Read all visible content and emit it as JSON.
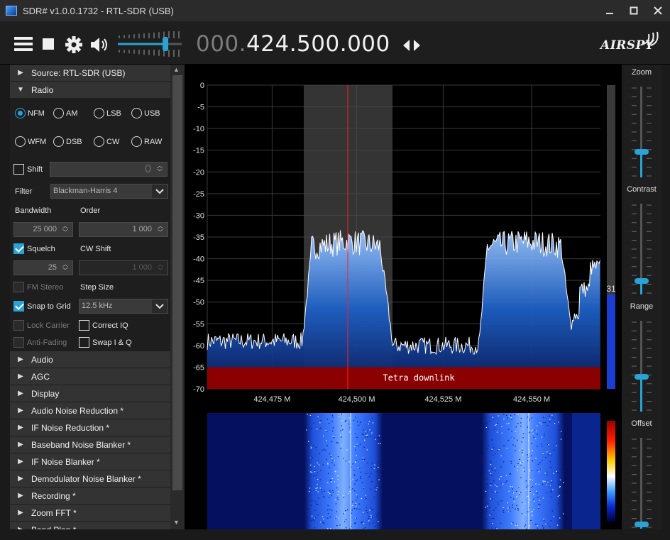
{
  "window": {
    "title": "SDR# v1.0.0.1732 - RTL-SDR (USB)",
    "controls": [
      "minimize",
      "maximize",
      "close"
    ]
  },
  "toolbar": {
    "icons": [
      "menu-icon",
      "stop-icon",
      "gear-icon",
      "speaker-icon"
    ],
    "volume_fraction": 0.78,
    "frequency_dim": "000.",
    "frequency_main": "424.500.000",
    "logo": "AIRSPY"
  },
  "sections_top": [
    {
      "label": "Source: RTL-SDR (USB)",
      "expanded": false
    },
    {
      "label": "Radio",
      "expanded": true
    }
  ],
  "radio": {
    "modes_row1": [
      "NFM",
      "AM",
      "LSB",
      "USB"
    ],
    "modes_row2": [
      "WFM",
      "DSB",
      "CW",
      "RAW"
    ],
    "selected_mode": "NFM",
    "shift_label": "Shift",
    "shift_value": "0",
    "filter_label": "Filter",
    "filter_value": "Blackman-Harris 4",
    "bandwidth_label": "Bandwidth",
    "bandwidth_value": "25 000",
    "order_label": "Order",
    "order_value": "1 000",
    "squelch_label": "Squelch",
    "squelch_value": "25",
    "cw_shift_label": "CW Shift",
    "cw_shift_value": "1 000",
    "fm_stereo_label": "FM Stereo",
    "step_size_label": "Step Size",
    "snap_label": "Snap to Grid",
    "step_size_value": "12.5 kHz",
    "lock_carrier_label": "Lock Carrier",
    "correct_iq_label": "Correct IQ",
    "anti_fading_label": "Anti-Fading",
    "swap_iq_label": "Swap I & Q"
  },
  "sections_bottom": [
    "Audio",
    "AGC",
    "Display",
    "Audio Noise Reduction *",
    "IF Noise Reduction *",
    "Baseband Noise Blanker *",
    "IF Noise Blanker *",
    "Demodulator Noise Blanker *",
    "Recording *",
    "Zoom FFT *",
    "Band Plan *"
  ],
  "spectrum": {
    "y_ticks": [
      "0",
      "-5",
      "-10",
      "-15",
      "-20",
      "-25",
      "-30",
      "-35",
      "-40",
      "-45",
      "-50",
      "-55",
      "-60",
      "-65",
      "-70"
    ],
    "x_ticks": [
      "424,475 M",
      "424,500 M",
      "424,525 M",
      "424,550 M"
    ],
    "band_label": "Tetra downlink",
    "level_value": "31",
    "accent": "#2aa2d6",
    "band_color": "#8b0000"
  },
  "right_panel": {
    "labels": [
      "Zoom",
      "Contrast",
      "Range",
      "Offset"
    ]
  }
}
